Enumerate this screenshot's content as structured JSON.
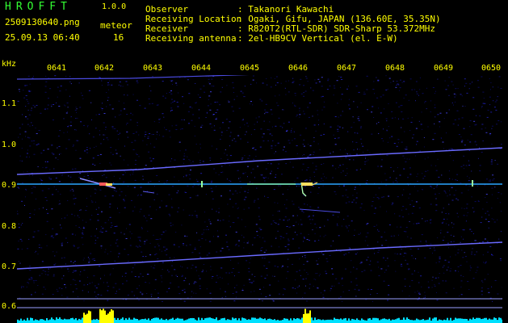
{
  "app": {
    "title": "HROFFT",
    "version": "1.0.0"
  },
  "file_name": "2509130640.png",
  "event_type": "meteor",
  "date_time": "25.09.13 06:40",
  "event_count": "16",
  "metadata": [
    {
      "label": "Observer",
      "value": ": Takanori Kawachi"
    },
    {
      "label": "Receiving Location",
      "value": ": Ogaki, Gifu, JAPAN (136.60E, 35.35N)"
    },
    {
      "label": "Receiver",
      "value": ": R820T2(RTL-SDR) SDR-Sharp 53.372MHz"
    },
    {
      "label": "Receiving antenna",
      "value": ": 2el-HB9CV Vertical (el. E-W)"
    }
  ],
  "axis": {
    "unit": "kHz",
    "time_ticks": [
      "0641",
      "0642",
      "0643",
      "0644",
      "0645",
      "0646",
      "0647",
      "0648",
      "0649",
      "0650"
    ],
    "freq_ticks": [
      "1.1",
      "1.0",
      "0.9",
      "0.8",
      "0.7",
      "0.6"
    ]
  },
  "colors": {
    "background": "#000000",
    "noise": "#0a0a5a",
    "trace": "#6a6aff",
    "carrier": "#3fb6ff",
    "text_yellow": "#ffff00",
    "text_green": "#33ff33",
    "power_cyan": "#00e0ff",
    "power_yellow": "#ffff00"
  }
}
